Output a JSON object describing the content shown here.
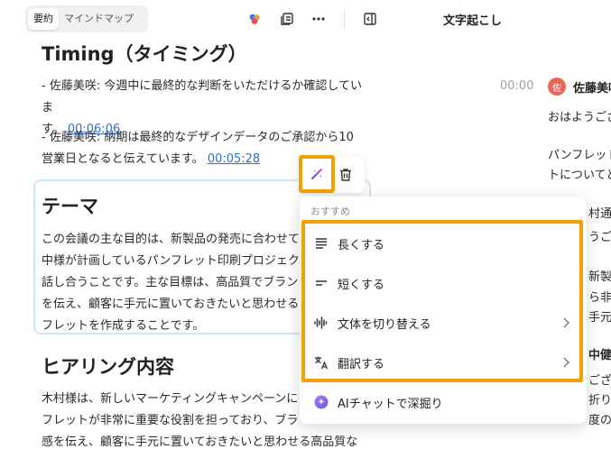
{
  "tabs": [
    {
      "label": "要約",
      "active": true
    },
    {
      "label": "マインドマップ",
      "active": false
    }
  ],
  "toolbar_icons": [
    "color-icon",
    "copy-icon",
    "more-icon",
    "panel-toggle-icon"
  ],
  "doc": {
    "timing_title": "Timing（タイミング）",
    "p1_text": "- 佐藤美咲: 今週中に最終的な判断をいただけるか確認していま",
    "p1_text_cont": "す。",
    "p1_ts": "00:06:06",
    "p2_text": "- 佐藤美咲: 納期は最終的なデザインデータのご承認から10",
    "p2_text_cont": "営業日となると伝えています。",
    "p2_ts": "00:05:28",
    "theme_title": "テーマ",
    "theme_lines": [
      "この会議の主な目的は、新製品の発売に合わせて",
      "中様が計画しているパンフレット印刷プロジェク",
      "話し合うことです。主な目標は、高品質でブラン",
      "を伝え、顧客に手元に置いておきたいと思わせる",
      "フレットを作成することです。"
    ],
    "hearing_title": "ヒアリング内容",
    "hearing_lines": [
      "木村様は、新しいマーケティングキャンペーンに",
      "フレットが非常に重要な役割を担っており、ブラ",
      "感を伝え、顧客に手元に置いておきたいと思わせる高品質な"
    ]
  },
  "menu": {
    "section": "おすすめ",
    "items": [
      {
        "label": "長くする",
        "icon": "lines-long-icon",
        "chevron": false
      },
      {
        "label": "短くする",
        "icon": "lines-short-icon",
        "chevron": false
      },
      {
        "label": "文体を切り替える",
        "icon": "waveform-icon",
        "chevron": true
      },
      {
        "label": "翻訳する",
        "icon": "translate-icon",
        "chevron": true
      },
      {
        "label": "AIチャットで深掘り",
        "icon": "ai-chat-icon",
        "chevron": false
      }
    ]
  },
  "transcript": {
    "title": "文字起こし",
    "time": "00:00",
    "avatar": "佐",
    "speaker": "佐藤美咲",
    "lines": [
      "おはようござ",
      "パンフレット",
      "トについてど"
    ],
    "fragments": [
      "村通",
      "うござ",
      "新製品",
      "ら非常",
      "手元に",
      "中健太",
      "ございま",
      "折りパ",
      "度のマ"
    ]
  },
  "colors": {
    "highlight": "#f5a000",
    "link": "#2f6fd1",
    "avatar": "#e8665a",
    "card_border": "#cfe3fb"
  }
}
